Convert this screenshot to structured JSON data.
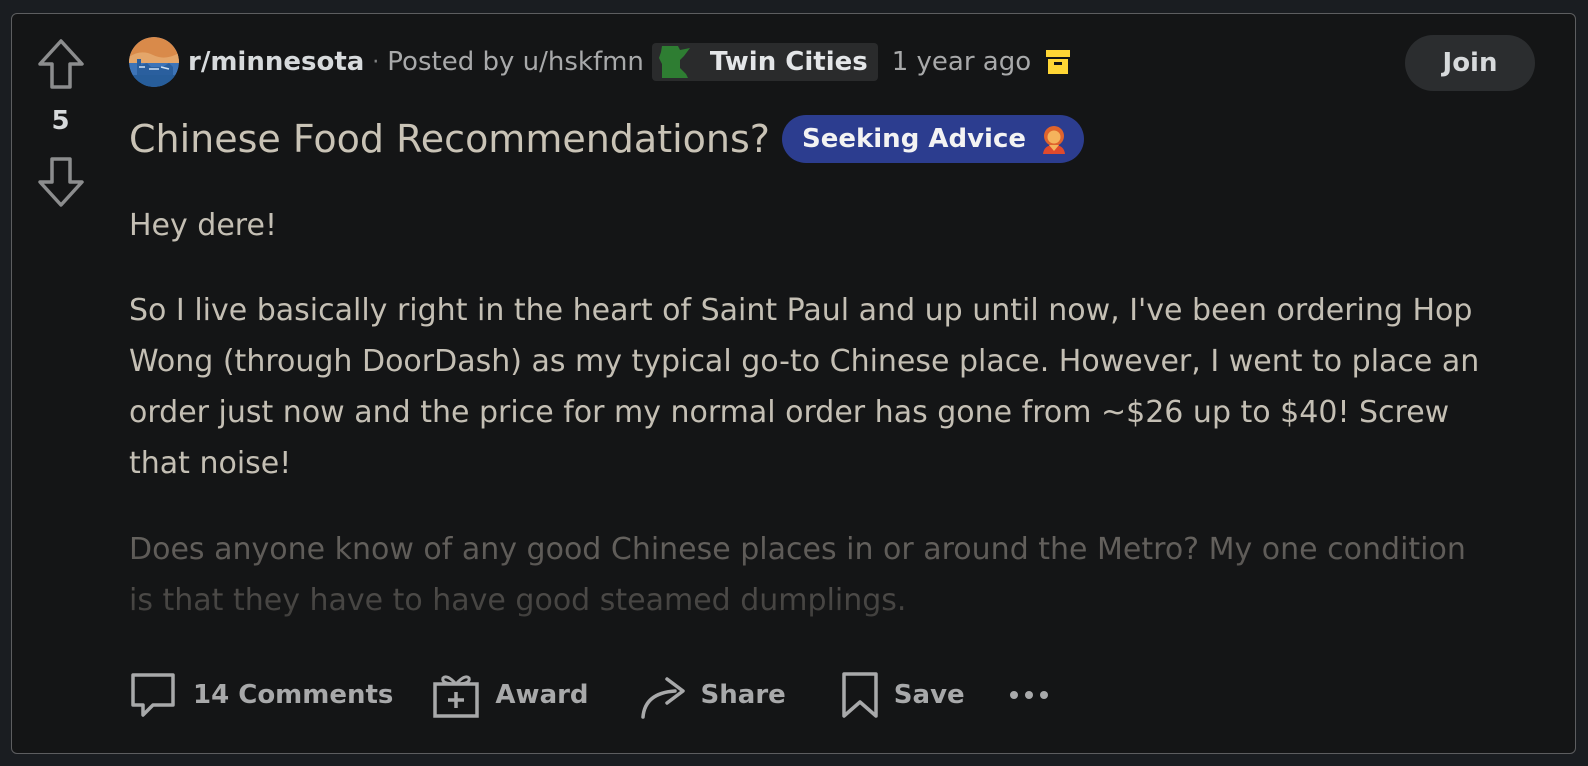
{
  "post": {
    "score": "5",
    "subreddit": "r/minnesota",
    "separator": "·",
    "posted_by_prefix": "Posted by",
    "author": "u/hskfmn",
    "user_flair": "Twin Cities",
    "time_ago": "1 year ago",
    "title": "Chinese Food Recommendations?",
    "post_flair": "Seeking Advice",
    "body": {
      "p1": "Hey dere!",
      "p2": "So I live basically right in the heart of Saint Paul and up until now, I've been ordering Hop Wong (through DoorDash) as my typical go-to Chinese place. However, I went to place an order just now and the price for my normal order has gone from ~$26 up to $40! Screw that noise!",
      "p3": "Does anyone know of any good Chinese places in or around the Metro? My one condition is that they have to have good steamed dumplings."
    }
  },
  "actions": {
    "join_label": "Join",
    "comments_label": "14 Comments",
    "award_label": "Award",
    "share_label": "Share",
    "save_label": "Save",
    "more_label": "•••"
  },
  "icons": {
    "upvote": "arrow-up-icon",
    "downvote": "arrow-down-icon",
    "subreddit": "subreddit-avatar",
    "user_flair": "minnesota-state-icon",
    "archived": "archive-icon",
    "post_flair": "person-emoji-icon",
    "comments": "speech-bubble-icon",
    "award": "gift-icon",
    "share": "share-arrow-icon",
    "save": "bookmark-icon",
    "more": "ellipsis-icon"
  },
  "colors": {
    "background": "#141516",
    "page": "#1a1d21",
    "post_flair_bg": "#2c3d8f",
    "archive_icon": "#ffd635",
    "flair_green": "#2e7d32"
  }
}
